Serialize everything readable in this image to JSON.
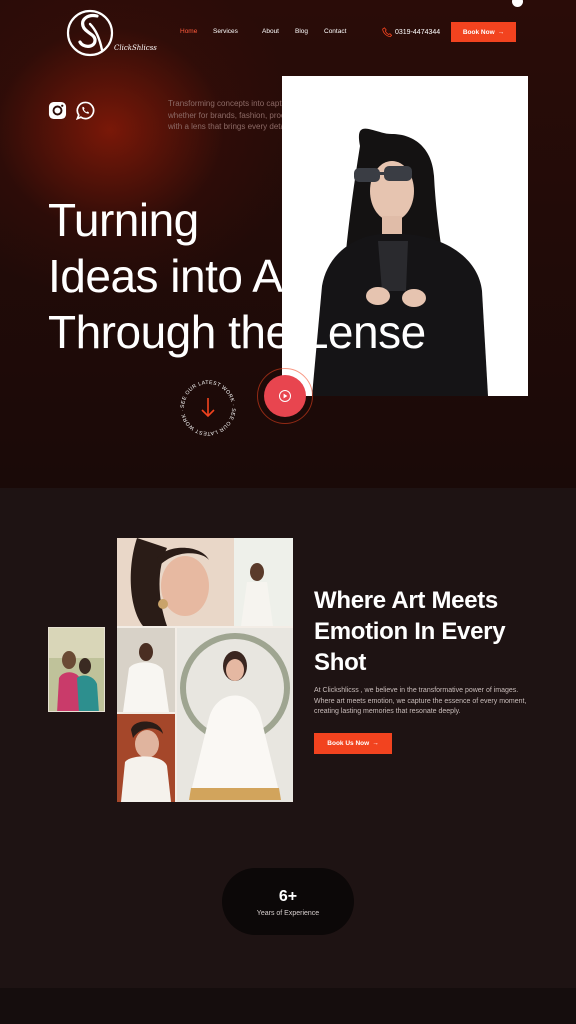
{
  "brand": {
    "logo_text": "ClickShlicss"
  },
  "nav": {
    "items": [
      {
        "label": "Home",
        "active": true
      },
      {
        "label": "Services",
        "active": false
      },
      {
        "label": "About",
        "active": false
      },
      {
        "label": "Blog",
        "active": false
      },
      {
        "label": "Contact",
        "active": false
      }
    ],
    "phone": "0319-4474344",
    "book_label": "Book Now",
    "book_arrow": "→"
  },
  "hero": {
    "tagline": "Transforming concepts into captivating visuals whether for brands, fashion, products, or events, with a lens that brings every detail to life.",
    "headline": [
      "Turning",
      "Ideas into Art",
      "Through the Lense"
    ],
    "circle_text": "SEE OUR LATEST WORK · SEE OUR LATEST WORK ·",
    "social_icons": [
      "instagram-icon",
      "whatsapp-icon"
    ]
  },
  "about": {
    "title": [
      "Where Art Meets",
      "Emotion In Every",
      "Shot"
    ],
    "body": "At Clickshlicss , we believe in the transformative power of images. Where art meets emotion, we capture the essence of every moment, creating lasting memories that resonate deeply.",
    "button_label": "Book Us Now",
    "button_arrow": "→"
  },
  "stats": {
    "value": "6+",
    "label": "Years of Experience"
  },
  "colors": {
    "accent": "#f2431f",
    "play": "#e8454f",
    "hero_bg": "#220b08",
    "section_bg": "#1e1313"
  }
}
